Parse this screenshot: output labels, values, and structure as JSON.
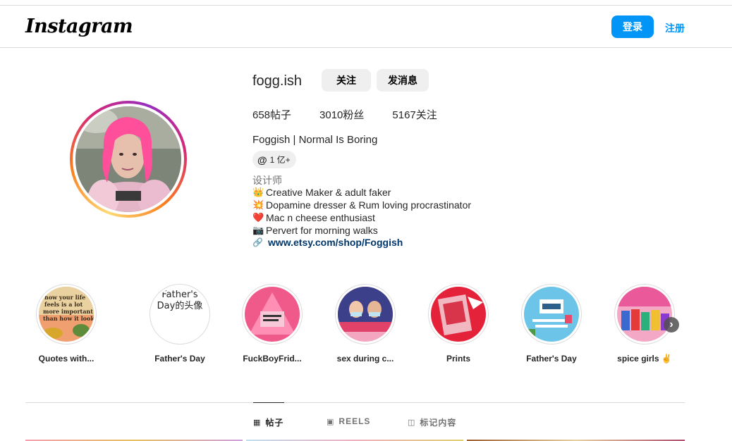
{
  "header": {
    "logo": "Instagram",
    "login_label": "登录",
    "signup_label": "注册"
  },
  "profile": {
    "username": "fogg.ish",
    "follow_label": "关注",
    "message_label": "发消息",
    "stats": {
      "posts": "658帖子",
      "followers": "3010粉丝",
      "following": "5167关注"
    },
    "full_name": "Foggish | Normal Is Boring",
    "threads_badge": "1 亿+",
    "threads_icon": "threads-icon",
    "category": "设计师",
    "bio_lines": [
      {
        "emoji": "👑",
        "text": "Creative Maker & adult faker"
      },
      {
        "emoji": "💥",
        "text": "Dopamine dresser & Rum loving procrastinator"
      },
      {
        "emoji": "❤️",
        "text": "Mac n cheese enthusiast"
      },
      {
        "emoji": "📷",
        "text": "Pervert for morning walks"
      }
    ],
    "link": "www.etsy.com/shop/Foggish"
  },
  "highlights": [
    {
      "label": "Quotes with..."
    },
    {
      "label": "Father's Day",
      "alt_text": "Father's Day的头像"
    },
    {
      "label": "FuckBoyFrid..."
    },
    {
      "label": "sex during c..."
    },
    {
      "label": "Prints"
    },
    {
      "label": "Father's Day"
    },
    {
      "label": "spice girls ✌️"
    }
  ],
  "tabs": [
    {
      "label": "帖子",
      "icon": "grid-icon",
      "active": true
    },
    {
      "label": "REELS",
      "icon": "reels-icon",
      "active": false
    },
    {
      "label": "标记内容",
      "icon": "tagged-icon",
      "active": false
    }
  ],
  "colors": {
    "accent": "#0095f6",
    "link": "#00376b",
    "button_gray": "#efefef"
  }
}
